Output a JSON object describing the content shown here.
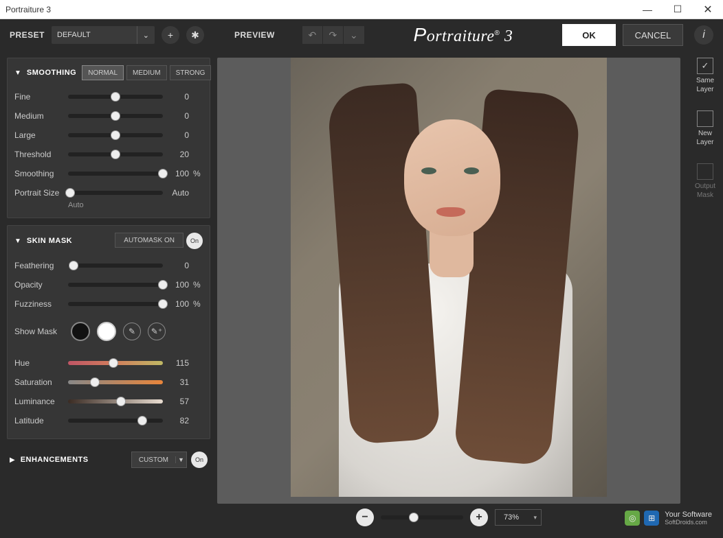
{
  "window": {
    "title": "Portraiture 3"
  },
  "toolbar": {
    "preset_label": "PRESET",
    "preset_value": "DEFAULT",
    "preview_label": "PREVIEW",
    "brand": "Portraiture® 3",
    "ok": "OK",
    "cancel": "CANCEL"
  },
  "smoothing": {
    "title": "SMOOTHING",
    "modes": {
      "normal": "NORMAL",
      "medium": "MEDIUM",
      "strong": "STRONG"
    },
    "sliders": {
      "fine": {
        "label": "Fine",
        "value": "0",
        "unit": "",
        "pos": 50
      },
      "medium": {
        "label": "Medium",
        "value": "0",
        "unit": "",
        "pos": 50
      },
      "large": {
        "label": "Large",
        "value": "0",
        "unit": "",
        "pos": 50
      },
      "threshold": {
        "label": "Threshold",
        "value": "20",
        "unit": "",
        "pos": 50
      },
      "smooth": {
        "label": "Smoothing",
        "value": "100",
        "unit": "%",
        "pos": 100
      },
      "psize": {
        "label": "Portrait Size",
        "value": "Auto",
        "unit": "",
        "pos": 2
      }
    },
    "psize_sub": "Auto"
  },
  "skinmask": {
    "title": "SKIN MASK",
    "automask": "AUTOMASK ON",
    "on": "On",
    "sliders": {
      "feather": {
        "label": "Feathering",
        "value": "0",
        "unit": "",
        "pos": 6
      },
      "opacity": {
        "label": "Opacity",
        "value": "100",
        "unit": "%",
        "pos": 100
      },
      "fuzz": {
        "label": "Fuzziness",
        "value": "100",
        "unit": "%",
        "pos": 100
      },
      "hue": {
        "label": "Hue",
        "value": "115",
        "unit": "",
        "pos": 48
      },
      "sat": {
        "label": "Saturation",
        "value": "31",
        "unit": "",
        "pos": 28
      },
      "lum": {
        "label": "Luminance",
        "value": "57",
        "unit": "",
        "pos": 56
      },
      "lat": {
        "label": "Latitude",
        "value": "82",
        "unit": "",
        "pos": 78
      }
    },
    "show_mask": "Show Mask"
  },
  "enhancements": {
    "title": "ENHANCEMENTS",
    "mode": "CUSTOM",
    "on": "On"
  },
  "zoom": {
    "value": "73%",
    "pos": 40
  },
  "rail": {
    "same_layer": "Same\nLayer",
    "new_layer": "New\nLayer",
    "output_mask": "Output\nMask"
  },
  "watermark": {
    "line1": "Your Software",
    "line2": "SoftDroids.com"
  }
}
